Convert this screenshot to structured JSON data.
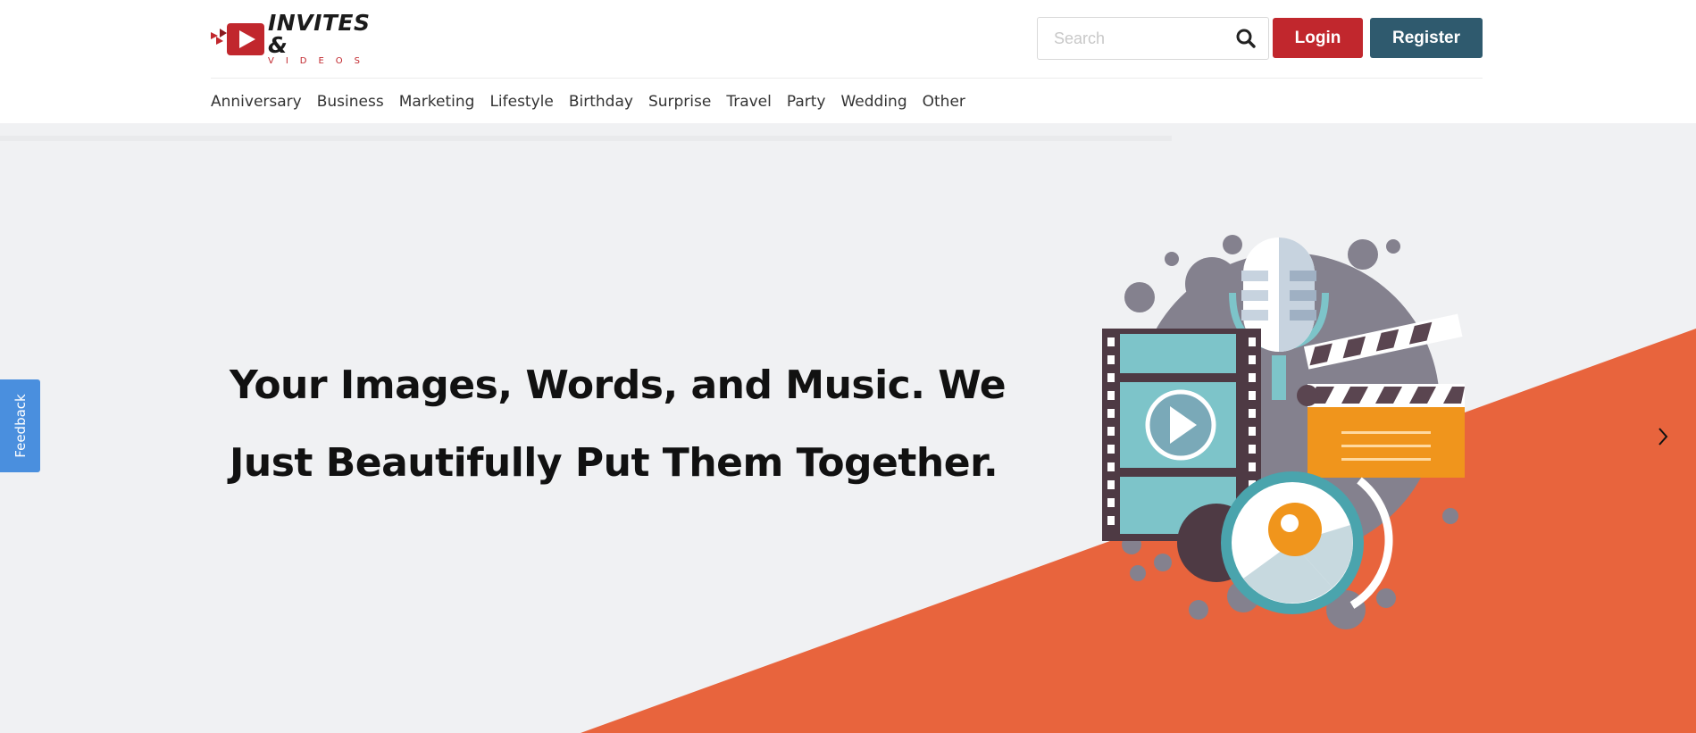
{
  "logo": {
    "line1": "INVITES &",
    "line2": "VIDEOS"
  },
  "search": {
    "placeholder": "Search"
  },
  "header": {
    "login_label": "Login",
    "register_label": "Register"
  },
  "nav": {
    "items": [
      {
        "label": "Anniversary"
      },
      {
        "label": "Business"
      },
      {
        "label": "Marketing"
      },
      {
        "label": "Lifestyle"
      },
      {
        "label": "Birthday"
      },
      {
        "label": "Surprise"
      },
      {
        "label": "Travel"
      },
      {
        "label": "Party"
      },
      {
        "label": "Wedding"
      },
      {
        "label": "Other"
      }
    ]
  },
  "hero": {
    "title": "Your Images, Words, and Music. We Just Beautifully Put Them Together."
  },
  "feedback": {
    "label": "Feedback"
  },
  "colors": {
    "brand_red": "#c1272d",
    "register_blue": "#2f5a6e",
    "hero_orange": "#e8643d",
    "feedback_blue": "#4a8fde"
  }
}
